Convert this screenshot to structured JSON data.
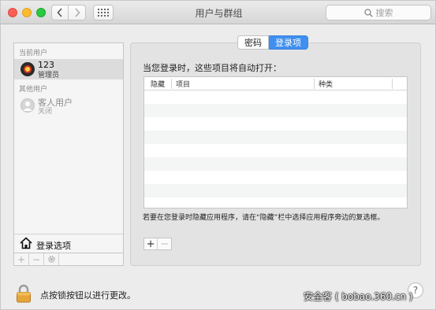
{
  "window": {
    "title": "用户与群组"
  },
  "search": {
    "placeholder": "搜索"
  },
  "users": {
    "current_label": "当前用户",
    "current_user": {
      "name": "123",
      "role": "管理员"
    },
    "other_label": "其他用户",
    "guest_user": {
      "name": "客人用户",
      "role": "关闭"
    },
    "login_options_label": "登录选项"
  },
  "tabs": [
    {
      "label": "密码",
      "selected": false
    },
    {
      "label": "登录项",
      "selected": true
    }
  ],
  "main": {
    "intro": "当您登录时，这些项目将自动打开：",
    "columns": [
      "隐藏",
      "项目",
      "种类"
    ],
    "note": "若要在您登录时隐藏应用程序，请在“隐藏”栏中选择应用程序旁边的复选框。"
  },
  "bottom": {
    "lock_text": "点按锁按钮以进行更改。"
  },
  "watermark": "安全客 ( bobao.360.cn )",
  "colors": {
    "accent": "#3f8ff0",
    "window_bg": "#ececec"
  }
}
